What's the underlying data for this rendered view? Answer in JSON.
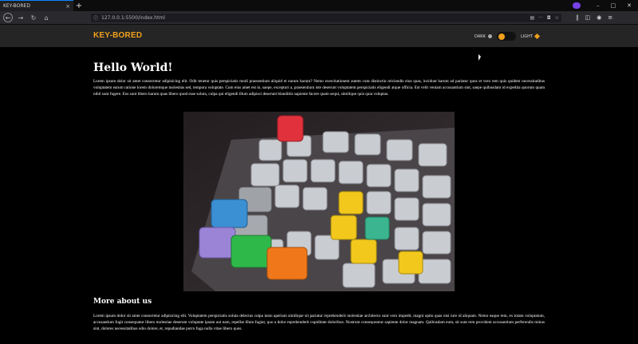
{
  "browser": {
    "tab_title": "KEY-BORED",
    "tab_close": "×",
    "new_tab": "+",
    "url": "127.0.0.1:5500/index.html",
    "window_controls": [
      "–",
      "□",
      "✕"
    ]
  },
  "site": {
    "logo": "KEY-BORED",
    "theme": {
      "dark_label": "DARK",
      "light_label": "LIGHT",
      "accent": "#f0a01d"
    }
  },
  "article": {
    "heading": "Hello World!",
    "intro": "Lorem ipsum dolor sit amet consectetur adipisicing elit. Odit tenetur quis perspiciatis modi praesentium aliquid et earum harum? Nemo exercitationem autem cum distinctio reiciendis eius quas, incidunt harum ad pariatur quos et vero rem quis quidem necessitatibus voluptatem earum ratione lorem doloremque molestias sed, tempora voluptate. Cum eius amet est in, saepe, excepturi a, praesentium iste deserunt voluptatem perspiciatis eligendi atque officia. Est velit veniam accusantium sint, saepe quibusdam id expedita quorum quam nihil sunt fugere. Eos sunt libero harum quas libero quod esse soluta, culpa qui eligendi illum adipisci deserunt blanditiis sapiente facere quam sequi, similique quis quia voluptas.",
    "subheading": "More about us",
    "more": "Lorem ipsum dolor sit amet consectetur adipisicing elit. Voluptatem perspiciatis soluta delectus culpa iusto aperiam similique sit pariatur reprehenderit molestiae architecto sunt vero impedit, magni optio quas nisi iure id aliquam. Nemo eaque rem, ex totam voluptatum, accusantium fugit consequatur libero molestiae deserunt voluptate ipsum aut nam, repellat illum fugiat, quo a dolor reprehenderit cupiditate doloribus. Nostrum consequuntur sapiente dolor magnam. Quibusdam eum, sit sunt rem provident accusantium perferendis minus sint, dolores necessitatibus odio dolore, et, repudiandae porro fuga nulla vitae libero quos."
  }
}
